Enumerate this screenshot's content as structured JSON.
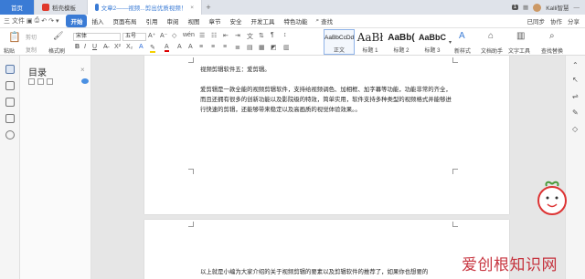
{
  "titlebar": {
    "tabs": [
      {
        "label": "首页"
      },
      {
        "label": "稻壳模板"
      },
      {
        "label": "文章2——视频...剪出优质视频！"
      }
    ],
    "add": "+",
    "badge": "1",
    "user": "Kalli智慧"
  },
  "menubar": {
    "file": "三 文件",
    "items": [
      "开始",
      "插入",
      "页面布局",
      "引用",
      "审阅",
      "视图",
      "章节",
      "安全",
      "开发工具",
      "特色功能"
    ],
    "search": "查找",
    "right": [
      "已同步",
      "协作",
      "分享"
    ]
  },
  "ribbon": {
    "paste": "粘贴",
    "cut": "剪切",
    "copy": "复制",
    "format_painter": "格式刷",
    "font_name": "宋体",
    "font_size": "五号",
    "styles": [
      {
        "sample": "AaBbCcDd",
        "name": "正文"
      },
      {
        "sample": "AaBł",
        "name": "标题 1"
      },
      {
        "sample": "AaBb(",
        "name": "标题 2"
      },
      {
        "sample": "AaBbC",
        "name": "标题 3"
      }
    ],
    "new_style": "新样式",
    "doc_assistant": "文档助手",
    "text_tools": "文字工具",
    "find_replace": "查找替换"
  },
  "toc": {
    "title": "目录"
  },
  "document": {
    "p1_line1": "视频剪辑软件五：爱剪辑。",
    "p1_para": "爱剪辑是一款全能的视频剪辑软件，支持给视频调色、加相框、加字幕等功能，功能非常的齐全，而且还拥有很多的创新功能以及影院级的特效，简单实用，软件支持多种类型的视频格式并能够进行快速的剪辑，还能够带来稳定以及高画质的视觉体验效果。。",
    "p2_line": "以上就是小编为大家介绍的关于视频剪辑的要素以及剪辑软件的推荐了，如果你也想要的"
  },
  "watermark": "爱创根知识网",
  "colors": {
    "accent": "#3a7bd5",
    "watermark": "#c2202c"
  }
}
